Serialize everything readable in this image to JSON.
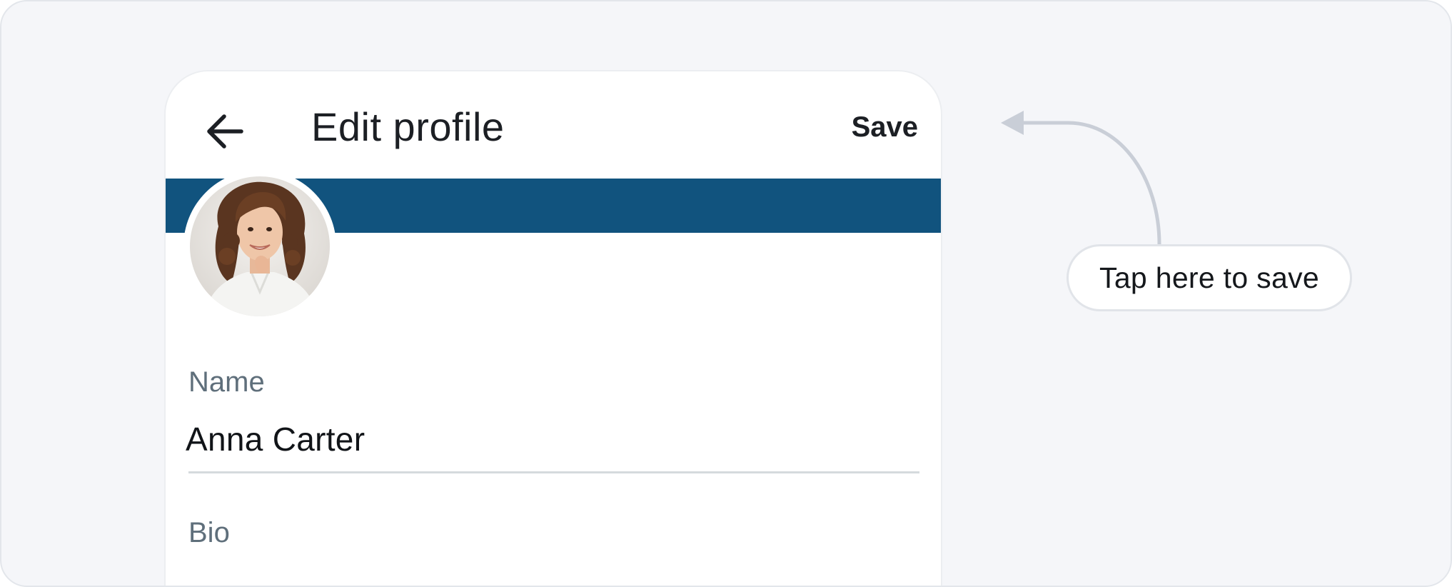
{
  "header": {
    "title": "Edit profile",
    "save_label": "Save",
    "back_icon": "arrow-left-icon"
  },
  "profile": {
    "banner_color": "#11537e",
    "avatar": "profile-photo"
  },
  "fields": [
    {
      "label": "Name",
      "value": "Anna Carter"
    },
    {
      "label": "Bio",
      "value": ""
    }
  ],
  "callout": {
    "text": "Tap here to save",
    "arrow_icon": "curved-arrow-left-icon"
  },
  "colors": {
    "accent": "#11537e",
    "background": "#f5f6f9",
    "text": "#1c1f24",
    "muted": "#5f6f7b"
  }
}
